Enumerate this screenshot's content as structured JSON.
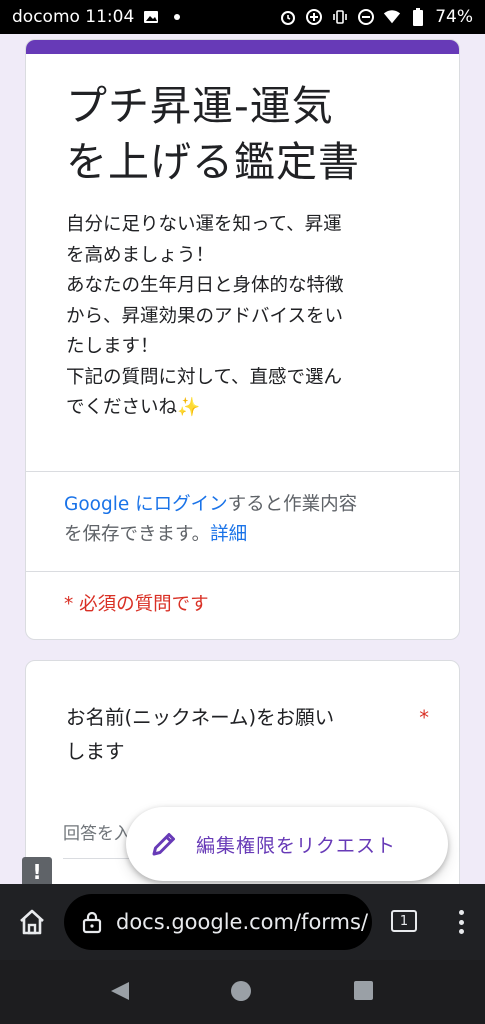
{
  "status_bar": {
    "carrier_time": "docomo 11:04",
    "battery": "74%"
  },
  "header": {
    "title_line1": "プチ昇運-運気",
    "title_line2": "を上げる鑑定書",
    "description": [
      "自分に足りない運を知って、昇運",
      "を高めましょう！",
      "あなたの生年月日と身体的な特徴",
      "から、昇運効果のアドバイスをい",
      "たします！",
      "下記の質問に対して、直感で選ん",
      "でくださいね✨"
    ],
    "login_link": "Google にログイン",
    "login_rest_line1": "すると作業内容",
    "login_line2": "を保存できます。",
    "details_link": "詳細",
    "required_note": "* 必須の質問です"
  },
  "question": {
    "title_line1": "お名前(ニックネーム)をお願い",
    "title_line2": "します",
    "required_mark": "*",
    "answer_placeholder": "回答を入力"
  },
  "fab": {
    "label": "編集権限をリクエスト"
  },
  "browser": {
    "url": "docs.google.com/forms/",
    "tab_count": "1"
  },
  "colors": {
    "accent": "#673ab7",
    "link": "#1a73e8",
    "required": "#d93025"
  }
}
